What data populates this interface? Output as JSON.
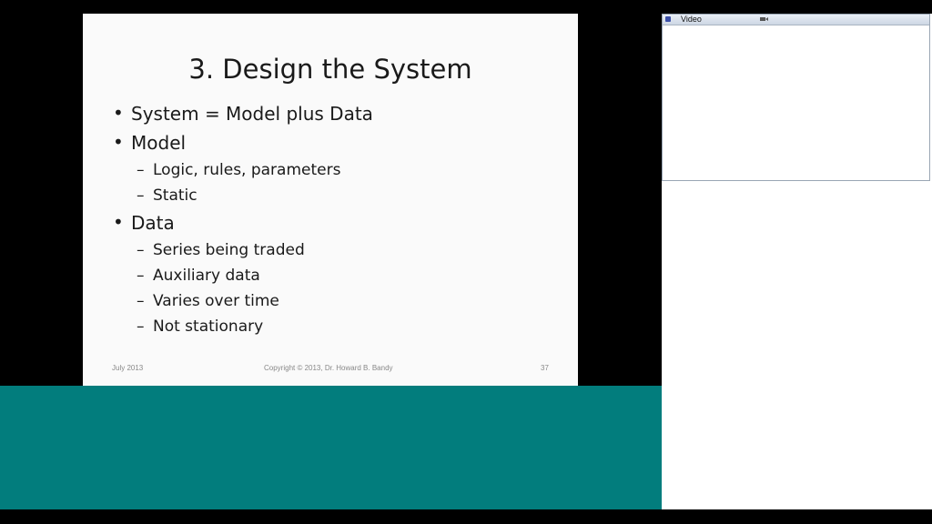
{
  "slide": {
    "title": "3.  Design the System",
    "bullets": [
      {
        "mark": "•",
        "text": "System = Model plus Data"
      },
      {
        "mark": "•",
        "text": "Model"
      },
      {
        "mark": "–",
        "text": "Logic, rules, parameters"
      },
      {
        "mark": "–",
        "text": "Static"
      },
      {
        "mark": "•",
        "text": "Data"
      },
      {
        "mark": "–",
        "text": "Series being traded"
      },
      {
        "mark": "–",
        "text": "Auxiliary data"
      },
      {
        "mark": "–",
        "text": "Varies over time"
      },
      {
        "mark": "–",
        "text": "Not stationary"
      }
    ],
    "footer": {
      "left": "July 2013",
      "center": "Copyright © 2013, Dr. Howard B. Bandy",
      "right": "37"
    }
  },
  "video_panel": {
    "title": "Video",
    "icons": [
      "app-icon",
      "camera-icon"
    ]
  },
  "colors": {
    "teal_panel": "#027d7d",
    "slide_bg": "#fafafa",
    "outer_bg": "#000000"
  }
}
